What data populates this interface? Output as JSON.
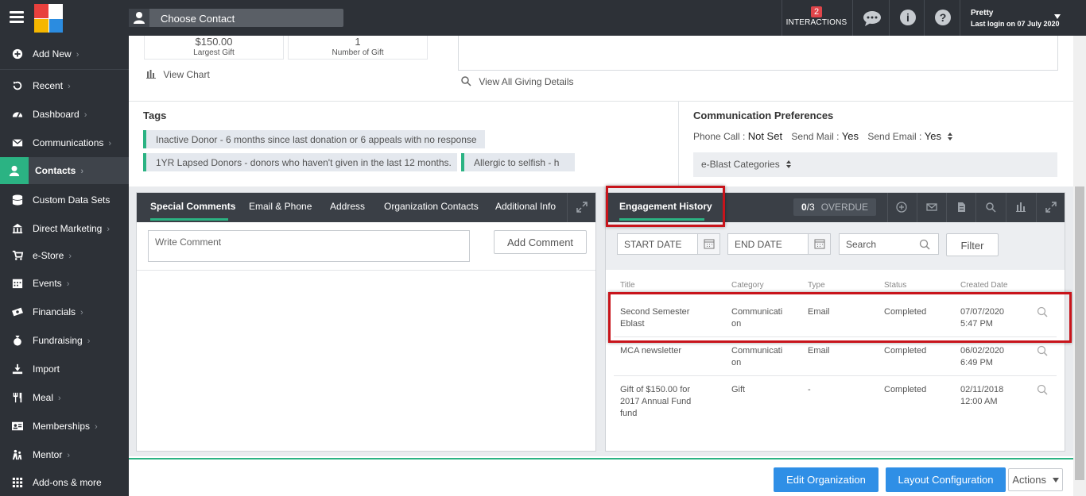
{
  "topbar": {
    "contact_placeholder": "Choose Contact",
    "interactions_count": "2",
    "interactions_label": "INTERACTIONS",
    "info_icon_glyph": "i",
    "help_icon_glyph": "?",
    "user_name": "Pretty",
    "last_login": "Last login on 07 July 2020",
    "logo_colors": [
      "#e8403d",
      "#ffffff",
      "#f5b700",
      "#2b8ce0"
    ]
  },
  "sidebar": {
    "items": [
      {
        "label": "Add New",
        "icon": "plus-circle-icon"
      },
      {
        "label": "Recent",
        "icon": "history-icon"
      },
      {
        "label": "Dashboard",
        "icon": "dashboard-icon"
      },
      {
        "label": "Communications",
        "icon": "envelope-icon"
      },
      {
        "label": "Contacts",
        "icon": "user-icon"
      },
      {
        "label": "Custom Data Sets",
        "icon": "database-icon"
      },
      {
        "label": "Direct Marketing",
        "icon": "bank-icon"
      },
      {
        "label": "e-Store",
        "icon": "cart-icon"
      },
      {
        "label": "Events",
        "icon": "calendar-icon"
      },
      {
        "label": "Financials",
        "icon": "money-icon"
      },
      {
        "label": "Fundraising",
        "icon": "money-bag-icon"
      },
      {
        "label": "Import",
        "icon": "import-icon"
      },
      {
        "label": "Meal",
        "icon": "utensils-icon"
      },
      {
        "label": "Memberships",
        "icon": "id-card-icon"
      },
      {
        "label": "Mentor",
        "icon": "mentor-icon"
      },
      {
        "label": "Add-ons & more",
        "icon": "apps-grid-icon"
      }
    ],
    "active": "Contacts",
    "chevron": "›"
  },
  "giving": {
    "largest_gift_value": "$150.00",
    "largest_gift_caption": "Largest Gift",
    "number_of_gift_value": "1",
    "number_of_gift_caption": "Number of Gift",
    "view_chart": "View Chart",
    "view_all": "View All Giving Details"
  },
  "tags": {
    "title": "Tags",
    "items": [
      "Inactive Donor - 6 months since last donation or 6 appeals with no response",
      "1YR Lapsed Donors - donors who haven't given in the last 12 months.",
      "Allergic to selfish - h"
    ]
  },
  "comm_prefs": {
    "title": "Communication Preferences",
    "phone_label": "Phone Call :",
    "phone_value": "Not Set",
    "mail_label": "Send Mail :",
    "mail_value": "Yes",
    "email_label": "Send Email :",
    "email_value": "Yes",
    "eblast": "e-Blast Categories"
  },
  "left_panel": {
    "tabs": [
      "Special Comments",
      "Email & Phone",
      "Address",
      "Organization Contacts",
      "Additional Info"
    ],
    "comment_placeholder": "Write Comment",
    "add_comment": "Add Comment"
  },
  "engagement": {
    "tab": "Engagement History",
    "overdue_count": "0",
    "overdue_total": "/3",
    "overdue_label": "OVERDUE",
    "start_date": "START DATE",
    "end_date": "END DATE",
    "search": "Search",
    "filter": "Filter",
    "columns": [
      "Title",
      "Category",
      "Type",
      "Status",
      "Created Date"
    ],
    "rows": [
      {
        "title": "Second Semester Eblast",
        "category": "Communication",
        "type": "Email",
        "status": "Completed",
        "created": "07/07/2020 5:47 PM"
      },
      {
        "title": "MCA newsletter",
        "category": "Communication",
        "type": "Email",
        "status": "Completed",
        "created": "06/02/2020 6:49 PM"
      },
      {
        "title": "Gift of $150.00 for 2017 Annual Fund fund",
        "category": "Gift",
        "type": "-",
        "status": "Completed",
        "created": "02/11/2018 12:00 AM"
      }
    ]
  },
  "footer": {
    "edit_org": "Edit Organization",
    "layout_config": "Layout Configuration",
    "actions": "Actions"
  },
  "colors": {
    "accent_green": "#2bb383",
    "dark_bar": "#2d3137",
    "button_blue": "#2f8fe6",
    "highlight_red": "#c8141b"
  }
}
